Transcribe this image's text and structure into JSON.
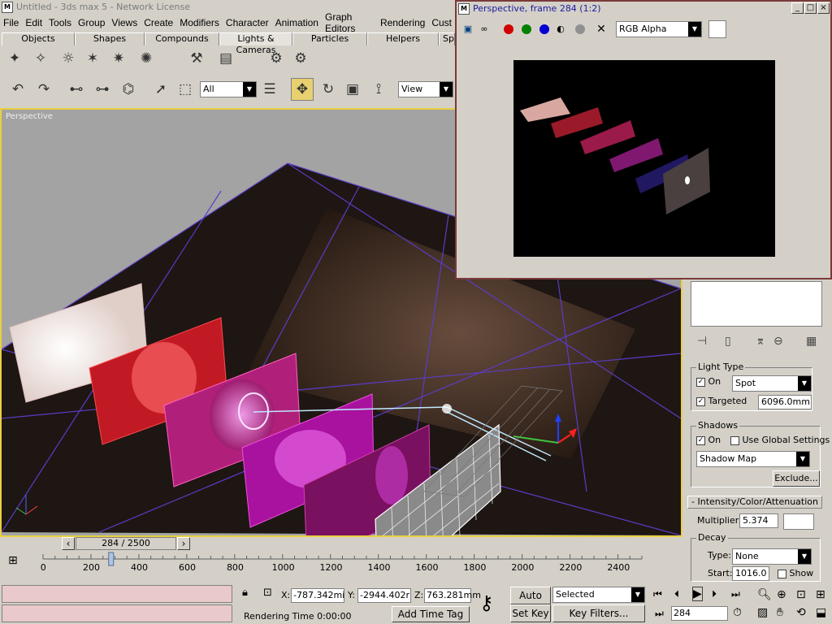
{
  "app": {
    "title": "Untitled - 3ds max 5 - Network License",
    "menu": [
      "File",
      "Edit",
      "Tools",
      "Group",
      "Views",
      "Create",
      "Modifiers",
      "Character",
      "Animation",
      "Graph Editors",
      "Rendering",
      "Cust"
    ],
    "tabs": [
      "Objects",
      "Shapes",
      "Compounds",
      "Lights & Cameras",
      "Particles",
      "Helpers",
      "Sp"
    ],
    "active_tab": "Lights & Cameras"
  },
  "toolbar": {
    "selection_filter": "All",
    "ref_coord": "View"
  },
  "viewport": {
    "label": "Perspective"
  },
  "render_window": {
    "title": "Perspective, frame 284 (1:2)",
    "channel": "RGB Alpha",
    "channel_colors": {
      "red": "#d00000",
      "green": "#008000",
      "blue": "#0000d0"
    }
  },
  "command_panel": {
    "light_type": {
      "title": "Light Type",
      "on_label": "On",
      "type": "Spot",
      "targeted_label": "Targeted",
      "target_distance": "6096.0mm"
    },
    "shadows": {
      "title": "Shadows",
      "on_label": "On",
      "use_global_label": "Use Global Settings",
      "type": "Shadow Map",
      "exclude_label": "Exclude..."
    },
    "intensity_rollout": "Intensity/Color/Attenuation",
    "multiplier_label": "Multiplier:",
    "multiplier": "5.374",
    "decay": {
      "title": "Decay",
      "type_label": "Type:",
      "type": "None",
      "start_label": "Start:",
      "start": "1016.0",
      "show_label": "Show"
    },
    "rollout_prefix": "-"
  },
  "timeline": {
    "frame_display": "284 / 2500",
    "current_frame": 284,
    "total_frames": 2500,
    "ticks": [
      "0",
      "200",
      "400",
      "600",
      "800",
      "1000",
      "1200",
      "1400",
      "1600",
      "1800",
      "2000",
      "2200",
      "2400"
    ]
  },
  "status": {
    "x_label": "X:",
    "x": "-787.342mi",
    "y_label": "Y:",
    "y": "-2944.402r",
    "z_label": "Z:",
    "z": "763.281mm",
    "rendering_time": "Rendering Time  0:00:00",
    "add_time_tag": "Add Time Tag",
    "auto_key": "Auto Key",
    "set_key": "Set Key",
    "key_mode": "Selected",
    "key_filters": "Key Filters...",
    "frame_field": "284"
  }
}
